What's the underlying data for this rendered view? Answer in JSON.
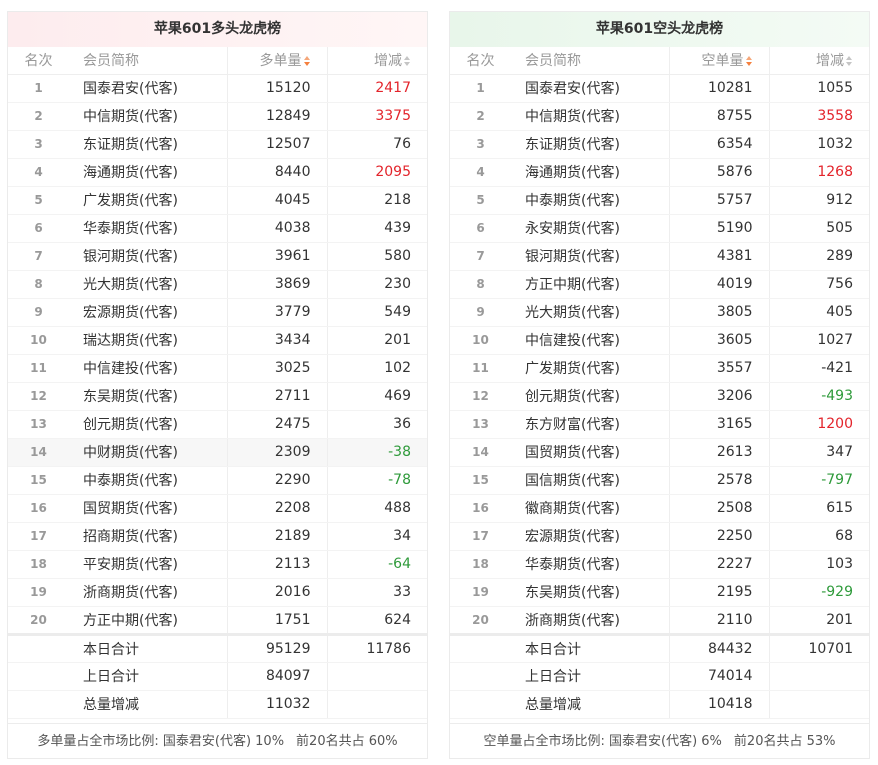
{
  "long": {
    "title": "苹果601多头龙虎榜",
    "headers": {
      "rank": "名次",
      "name": "会员简称",
      "vol": "多单量",
      "chg": "增减"
    },
    "rows": [
      {
        "rank": "1",
        "name": "国泰君安(代客)",
        "vol": "15120",
        "chg": "2417",
        "dir": "up"
      },
      {
        "rank": "2",
        "name": "中信期货(代客)",
        "vol": "12849",
        "chg": "3375",
        "dir": "up"
      },
      {
        "rank": "3",
        "name": "东证期货(代客)",
        "vol": "12507",
        "chg": "76",
        "dir": ""
      },
      {
        "rank": "4",
        "name": "海通期货(代客)",
        "vol": "8440",
        "chg": "2095",
        "dir": "up"
      },
      {
        "rank": "5",
        "name": "广发期货(代客)",
        "vol": "4045",
        "chg": "218",
        "dir": ""
      },
      {
        "rank": "6",
        "name": "华泰期货(代客)",
        "vol": "4038",
        "chg": "439",
        "dir": ""
      },
      {
        "rank": "7",
        "name": "银河期货(代客)",
        "vol": "3961",
        "chg": "580",
        "dir": ""
      },
      {
        "rank": "8",
        "name": "光大期货(代客)",
        "vol": "3869",
        "chg": "230",
        "dir": ""
      },
      {
        "rank": "9",
        "name": "宏源期货(代客)",
        "vol": "3779",
        "chg": "549",
        "dir": ""
      },
      {
        "rank": "10",
        "name": "瑞达期货(代客)",
        "vol": "3434",
        "chg": "201",
        "dir": ""
      },
      {
        "rank": "11",
        "name": "中信建投(代客)",
        "vol": "3025",
        "chg": "102",
        "dir": ""
      },
      {
        "rank": "12",
        "name": "东吴期货(代客)",
        "vol": "2711",
        "chg": "469",
        "dir": ""
      },
      {
        "rank": "13",
        "name": "创元期货(代客)",
        "vol": "2475",
        "chg": "36",
        "dir": ""
      },
      {
        "rank": "14",
        "name": "中财期货(代客)",
        "vol": "2309",
        "chg": "-38",
        "dir": "down"
      },
      {
        "rank": "15",
        "name": "中泰期货(代客)",
        "vol": "2290",
        "chg": "-78",
        "dir": "down"
      },
      {
        "rank": "16",
        "name": "国贸期货(代客)",
        "vol": "2208",
        "chg": "488",
        "dir": ""
      },
      {
        "rank": "17",
        "name": "招商期货(代客)",
        "vol": "2189",
        "chg": "34",
        "dir": ""
      },
      {
        "rank": "18",
        "name": "平安期货(代客)",
        "vol": "2113",
        "chg": "-64",
        "dir": "down"
      },
      {
        "rank": "19",
        "name": "浙商期货(代客)",
        "vol": "2016",
        "chg": "33",
        "dir": ""
      },
      {
        "rank": "20",
        "name": "方正中期(代客)",
        "vol": "1751",
        "chg": "624",
        "dir": ""
      }
    ],
    "summary": [
      {
        "label": "本日合计",
        "vol": "95129",
        "chg": "11786"
      },
      {
        "label": "上日合计",
        "vol": "84097",
        "chg": ""
      },
      {
        "label": "总量增减",
        "vol": "11032",
        "chg": ""
      }
    ],
    "footer": {
      "ratio": "多单量占全市场比例: 国泰君安(代客) 10%",
      "top20": "前20名共占 60%"
    }
  },
  "short": {
    "title": "苹果601空头龙虎榜",
    "headers": {
      "rank": "名次",
      "name": "会员简称",
      "vol": "空单量",
      "chg": "增减"
    },
    "rows": [
      {
        "rank": "1",
        "name": "国泰君安(代客)",
        "vol": "10281",
        "chg": "1055",
        "dir": ""
      },
      {
        "rank": "2",
        "name": "中信期货(代客)",
        "vol": "8755",
        "chg": "3558",
        "dir": "up"
      },
      {
        "rank": "3",
        "name": "东证期货(代客)",
        "vol": "6354",
        "chg": "1032",
        "dir": ""
      },
      {
        "rank": "4",
        "name": "海通期货(代客)",
        "vol": "5876",
        "chg": "1268",
        "dir": "up"
      },
      {
        "rank": "5",
        "name": "中泰期货(代客)",
        "vol": "5757",
        "chg": "912",
        "dir": ""
      },
      {
        "rank": "6",
        "name": "永安期货(代客)",
        "vol": "5190",
        "chg": "505",
        "dir": ""
      },
      {
        "rank": "7",
        "name": "银河期货(代客)",
        "vol": "4381",
        "chg": "289",
        "dir": ""
      },
      {
        "rank": "8",
        "name": "方正中期(代客)",
        "vol": "4019",
        "chg": "756",
        "dir": ""
      },
      {
        "rank": "9",
        "name": "光大期货(代客)",
        "vol": "3805",
        "chg": "405",
        "dir": ""
      },
      {
        "rank": "10",
        "name": "中信建投(代客)",
        "vol": "3605",
        "chg": "1027",
        "dir": ""
      },
      {
        "rank": "11",
        "name": "广发期货(代客)",
        "vol": "3557",
        "chg": "-421",
        "dir": ""
      },
      {
        "rank": "12",
        "name": "创元期货(代客)",
        "vol": "3206",
        "chg": "-493",
        "dir": "down"
      },
      {
        "rank": "13",
        "name": "东方财富(代客)",
        "vol": "3165",
        "chg": "1200",
        "dir": "up"
      },
      {
        "rank": "14",
        "name": "国贸期货(代客)",
        "vol": "2613",
        "chg": "347",
        "dir": ""
      },
      {
        "rank": "15",
        "name": "国信期货(代客)",
        "vol": "2578",
        "chg": "-797",
        "dir": "down"
      },
      {
        "rank": "16",
        "name": "徽商期货(代客)",
        "vol": "2508",
        "chg": "615",
        "dir": ""
      },
      {
        "rank": "17",
        "name": "宏源期货(代客)",
        "vol": "2250",
        "chg": "68",
        "dir": ""
      },
      {
        "rank": "18",
        "name": "华泰期货(代客)",
        "vol": "2227",
        "chg": "103",
        "dir": ""
      },
      {
        "rank": "19",
        "name": "东吴期货(代客)",
        "vol": "2195",
        "chg": "-929",
        "dir": "down"
      },
      {
        "rank": "20",
        "name": "浙商期货(代客)",
        "vol": "2110",
        "chg": "201",
        "dir": ""
      }
    ],
    "summary": [
      {
        "label": "本日合计",
        "vol": "84432",
        "chg": "10701"
      },
      {
        "label": "上日合计",
        "vol": "74014",
        "chg": ""
      },
      {
        "label": "总量增减",
        "vol": "10418",
        "chg": ""
      }
    ],
    "footer": {
      "ratio": "空单量占全市场比例: 国泰君安(代客) 6%",
      "top20": "前20名共占 53%"
    }
  },
  "colors": {
    "up": "#e3242b",
    "down": "#2e9a3a",
    "sort_active": "#f5803e"
  },
  "highlighted_row": {
    "panel": "long",
    "rank": "14"
  }
}
